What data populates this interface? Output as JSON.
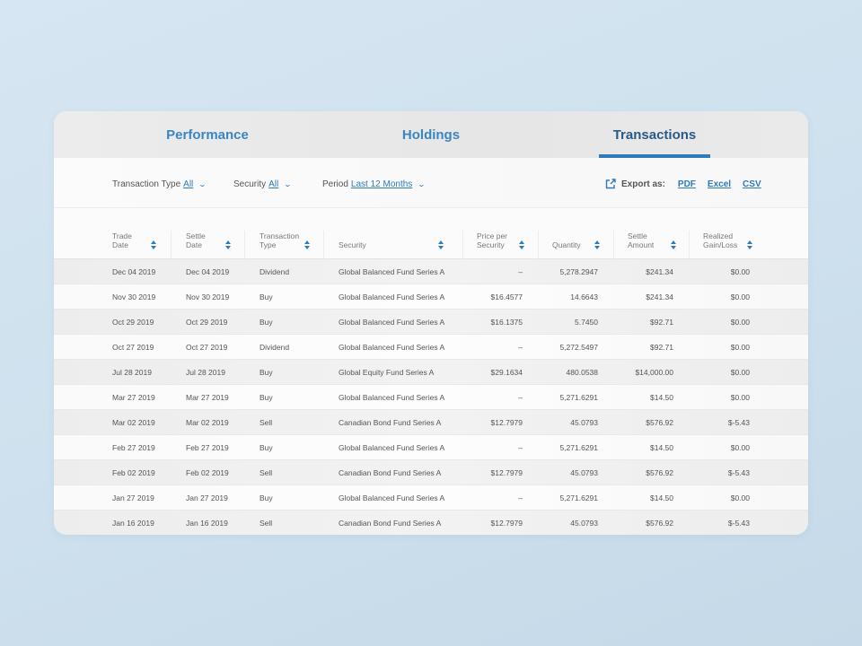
{
  "tabs": [
    {
      "label": "Performance",
      "active": false
    },
    {
      "label": "Holdings",
      "active": false
    },
    {
      "label": "Transactions",
      "active": true
    }
  ],
  "filters": {
    "transaction_type": {
      "label": "Transaction Type",
      "value": "All"
    },
    "security": {
      "label": "Security",
      "value": "All"
    },
    "period": {
      "label": "Period",
      "value": "Last 12 Months"
    }
  },
  "export": {
    "icon": "external-link-icon",
    "label": "Export as:",
    "options": [
      "PDF",
      "Excel",
      "CSV"
    ]
  },
  "colors": {
    "accent": "#2f7ab8",
    "active_tab_text": "#2a5a86",
    "background": "#d0e2ee"
  },
  "table": {
    "columns": [
      {
        "line1": "Trade",
        "line2": "Date",
        "sortable": true
      },
      {
        "line1": "Settle",
        "line2": "Date",
        "sortable": true
      },
      {
        "line1": "Transaction",
        "line2": "Type",
        "sortable": true
      },
      {
        "line1": "",
        "line2": "Security",
        "sortable": true
      },
      {
        "line1": "Price per",
        "line2": "Security",
        "sortable": true
      },
      {
        "line1": "",
        "line2": "Quantity",
        "sortable": true
      },
      {
        "line1": "Settle",
        "line2": "Amount",
        "sortable": true
      },
      {
        "line1": "Realized",
        "line2": "Gain/Loss",
        "sortable": true
      }
    ],
    "rows": [
      {
        "trade": "Dec 04 2019",
        "settle": "Dec 04 2019",
        "type": "Dividend",
        "security": "Global Balanced Fund Series A",
        "price": "–",
        "qty": "5,278.2947",
        "amount": "$241.34",
        "gain": "$0.00"
      },
      {
        "trade": "Nov 30 2019",
        "settle": "Nov 30 2019",
        "type": "Buy",
        "security": "Global Balanced Fund Series A",
        "price": "$16.4577",
        "qty": "14.6643",
        "amount": "$241.34",
        "gain": "$0.00"
      },
      {
        "trade": "Oct 29 2019",
        "settle": "Oct 29 2019",
        "type": "Buy",
        "security": "Global Balanced Fund Series A",
        "price": "$16.1375",
        "qty": "5.7450",
        "amount": "$92.71",
        "gain": "$0.00"
      },
      {
        "trade": "Oct 27 2019",
        "settle": "Oct 27 2019",
        "type": "Dividend",
        "security": "Global Balanced Fund Series A",
        "price": "–",
        "qty": "5,272.5497",
        "amount": "$92.71",
        "gain": "$0.00"
      },
      {
        "trade": "Jul 28 2019",
        "settle": "Jul 28 2019",
        "type": "Buy",
        "security": "Global Equity Fund Series A",
        "price": "$29.1634",
        "qty": "480.0538",
        "amount": "$14,000.00",
        "gain": "$0.00"
      },
      {
        "trade": "Mar 27 2019",
        "settle": "Mar 27 2019",
        "type": "Buy",
        "security": "Global Balanced Fund Series A",
        "price": "–",
        "qty": "5,271.6291",
        "amount": "$14.50",
        "gain": "$0.00"
      },
      {
        "trade": "Mar 02 2019",
        "settle": "Mar 02 2019",
        "type": "Sell",
        "security": "Canadian Bond Fund Series A",
        "price": "$12.7979",
        "qty": "45.0793",
        "amount": "$576.92",
        "gain": "$-5.43"
      },
      {
        "trade": "Feb 27 2019",
        "settle": "Feb 27 2019",
        "type": "Buy",
        "security": "Global Balanced Fund Series A",
        "price": "–",
        "qty": "5,271.6291",
        "amount": "$14.50",
        "gain": "$0.00"
      },
      {
        "trade": "Feb 02 2019",
        "settle": "Feb 02 2019",
        "type": "Sell",
        "security": "Canadian Bond Fund Series A",
        "price": "$12.7979",
        "qty": "45.0793",
        "amount": "$576.92",
        "gain": "$-5.43"
      },
      {
        "trade": "Jan 27 2019",
        "settle": "Jan 27 2019",
        "type": "Buy",
        "security": "Global Balanced Fund Series A",
        "price": "–",
        "qty": "5,271.6291",
        "amount": "$14.50",
        "gain": "$0.00"
      },
      {
        "trade": "Jan 16 2019",
        "settle": "Jan 16 2019",
        "type": "Sell",
        "security": "Canadian Bond Fund Series A",
        "price": "$12.7979",
        "qty": "45.0793",
        "amount": "$576.92",
        "gain": "$-5.43"
      }
    ]
  }
}
